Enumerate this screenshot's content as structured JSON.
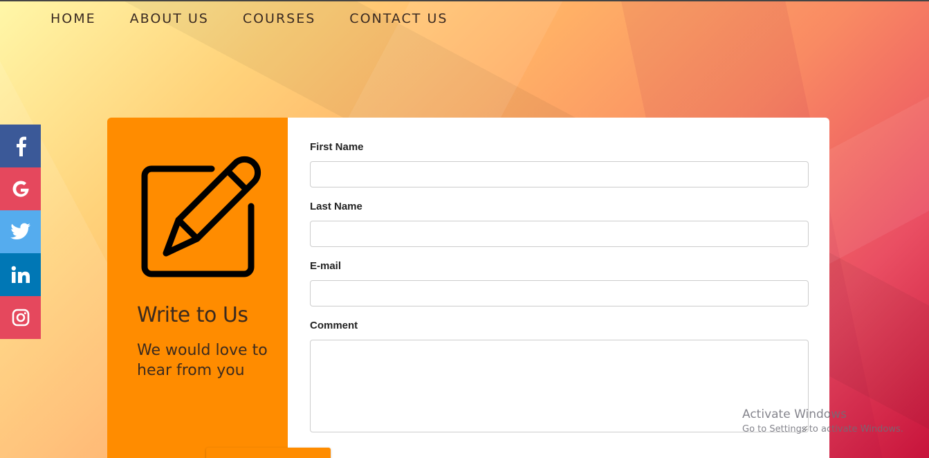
{
  "nav": {
    "items": [
      {
        "label": "HOME"
      },
      {
        "label": "ABOUT US"
      },
      {
        "label": "COURSES"
      },
      {
        "label": "CONTACT US"
      }
    ]
  },
  "social": {
    "items": [
      {
        "icon": "facebook-icon",
        "color": "#3b5998"
      },
      {
        "icon": "google-icon",
        "color": "#e5485d"
      },
      {
        "icon": "twitter-icon",
        "color": "#55acee"
      },
      {
        "icon": "linkedin-icon",
        "color": "#0077b5"
      },
      {
        "icon": "instagram-icon",
        "color": "#e5485d"
      }
    ]
  },
  "card": {
    "accent_color": "#ff8c00",
    "icon": "edit-pencil-icon",
    "title": "Write to Us",
    "subtitle": "We would love to hear from you"
  },
  "form": {
    "first_name": {
      "label": "First Name",
      "value": "",
      "placeholder": ""
    },
    "last_name": {
      "label": "Last Name",
      "value": "",
      "placeholder": ""
    },
    "email": {
      "label": "E-mail",
      "value": "",
      "placeholder": ""
    },
    "comment": {
      "label": "Comment",
      "value": "",
      "placeholder": ""
    }
  },
  "watermark": {
    "line1": "Activate Windows",
    "line2": "Go to Settings to activate Windows."
  }
}
